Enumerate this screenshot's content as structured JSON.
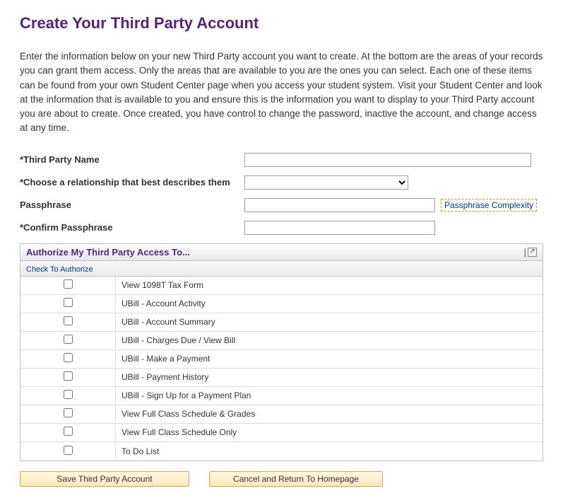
{
  "page": {
    "title": "Create Your Third Party Account",
    "intro": "Enter the information below on your new Third Party account you want to create. At the bottom are the areas of your records you can grant them access. Only the areas that are available to you are the ones you can select. Each one of these items can be found from your own Student Center page when you access your student system. Visit your Student Center and look at the information that is available to you and ensure this is the information you want to display to your Third Party account you are about to create. Once created, you have control to change the password, inactive the account, and change access at any time."
  },
  "form": {
    "name_label": "*Third Party Name",
    "name_value": "",
    "relationship_label": "*Choose a relationship that best describes them",
    "relationship_selected": "",
    "passphrase_label": " Passphrase",
    "passphrase_value": "",
    "passphrase_link": "Passphrase Complexity",
    "confirm_label": "*Confirm Passphrase",
    "confirm_value": ""
  },
  "grid": {
    "title": "Authorize My Third Party Access To...",
    "check_header": "Check To Authorize",
    "rows": [
      {
        "label": "View 1098T Tax Form"
      },
      {
        "label": "UBill - Account Activity"
      },
      {
        "label": "UBill - Account Summary"
      },
      {
        "label": "UBill - Charges Due / View Bill"
      },
      {
        "label": "UBill - Make a Payment"
      },
      {
        "label": "UBill - Payment History"
      },
      {
        "label": "UBill - Sign Up for a Payment Plan"
      },
      {
        "label": "View Full Class Schedule & Grades"
      },
      {
        "label": "View Full Class Schedule Only"
      },
      {
        "label": "To Do List"
      }
    ]
  },
  "buttons": {
    "save": "Save Third Party Account",
    "cancel": "Cancel and Return To Homepage"
  }
}
